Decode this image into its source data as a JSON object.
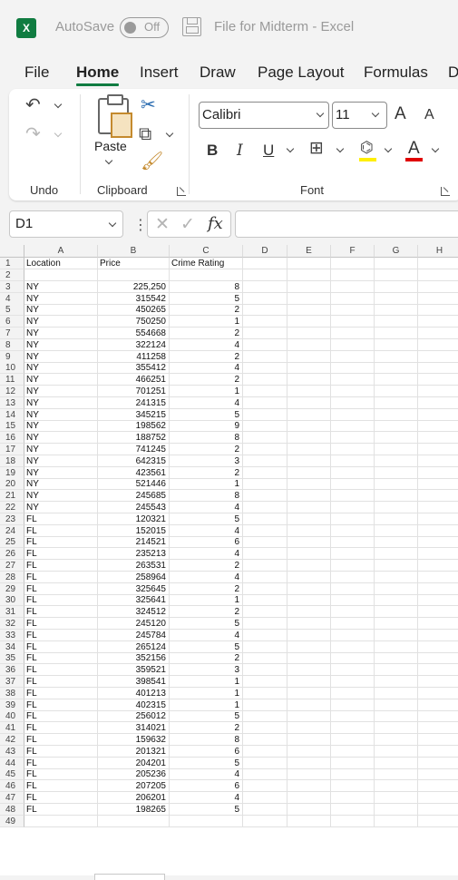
{
  "titlebar": {
    "app_logo": "X",
    "autosave_label": "AutoSave",
    "autosave_state": "Off",
    "document_title": "File for Midterm  -  Excel"
  },
  "tabs": [
    "File",
    "Home",
    "Insert",
    "Draw",
    "Page Layout",
    "Formulas",
    "D"
  ],
  "active_tab": "Home",
  "ribbon": {
    "groups": {
      "undo": "Undo",
      "clipboard": "Clipboard",
      "font": "Font"
    },
    "paste_label": "Paste",
    "font_name": "Calibri",
    "font_size": "11",
    "bold": "B",
    "italic": "I",
    "underline": "U",
    "grow_font": "A",
    "shrink_font": "A",
    "font_color_glyph": "A",
    "highlight_color": "#ffef00",
    "font_color": "#e00000"
  },
  "formula_bar": {
    "name_box": "D1",
    "fx": "fx",
    "value": ""
  },
  "accent_color": "#107c41",
  "columns": [
    "A",
    "B",
    "C",
    "D",
    "E",
    "F",
    "G",
    "H"
  ],
  "header_row": {
    "row": "1",
    "a": "Location",
    "b": "Price",
    "c": "Crime Rating"
  },
  "rows": [
    {
      "row": "2",
      "a": "",
      "b": "",
      "c": ""
    },
    {
      "row": "3",
      "a": "NY",
      "b": "225,250",
      "c": "8"
    },
    {
      "row": "4",
      "a": "NY",
      "b": "315542",
      "c": "5"
    },
    {
      "row": "5",
      "a": "NY",
      "b": "450265",
      "c": "2"
    },
    {
      "row": "6",
      "a": "NY",
      "b": "750250",
      "c": "1"
    },
    {
      "row": "7",
      "a": "NY",
      "b": "554668",
      "c": "2"
    },
    {
      "row": "8",
      "a": "NY",
      "b": "322124",
      "c": "4"
    },
    {
      "row": "9",
      "a": "NY",
      "b": "411258",
      "c": "2"
    },
    {
      "row": "10",
      "a": "NY",
      "b": "355412",
      "c": "4"
    },
    {
      "row": "11",
      "a": "NY",
      "b": "466251",
      "c": "2"
    },
    {
      "row": "12",
      "a": "NY",
      "b": "701251",
      "c": "1"
    },
    {
      "row": "13",
      "a": "NY",
      "b": "241315",
      "c": "4"
    },
    {
      "row": "14",
      "a": "NY",
      "b": "345215",
      "c": "5"
    },
    {
      "row": "15",
      "a": "NY",
      "b": "198562",
      "c": "9"
    },
    {
      "row": "16",
      "a": "NY",
      "b": "188752",
      "c": "8"
    },
    {
      "row": "17",
      "a": "NY",
      "b": "741245",
      "c": "2"
    },
    {
      "row": "18",
      "a": "NY",
      "b": "642315",
      "c": "3"
    },
    {
      "row": "19",
      "a": "NY",
      "b": "423561",
      "c": "2"
    },
    {
      "row": "20",
      "a": "NY",
      "b": "521446",
      "c": "1"
    },
    {
      "row": "21",
      "a": "NY",
      "b": "245685",
      "c": "8"
    },
    {
      "row": "22",
      "a": "NY",
      "b": "245543",
      "c": "4"
    },
    {
      "row": "23",
      "a": "FL",
      "b": "120321",
      "c": "5"
    },
    {
      "row": "24",
      "a": "FL",
      "b": "152015",
      "c": "4"
    },
    {
      "row": "25",
      "a": "FL",
      "b": "214521",
      "c": "6"
    },
    {
      "row": "26",
      "a": "FL",
      "b": "235213",
      "c": "4"
    },
    {
      "row": "27",
      "a": "FL",
      "b": "263531",
      "c": "2"
    },
    {
      "row": "28",
      "a": "FL",
      "b": "258964",
      "c": "4"
    },
    {
      "row": "29",
      "a": "FL",
      "b": "325645",
      "c": "2"
    },
    {
      "row": "30",
      "a": "FL",
      "b": "325641",
      "c": "1"
    },
    {
      "row": "31",
      "a": "FL",
      "b": "324512",
      "c": "2"
    },
    {
      "row": "32",
      "a": "FL",
      "b": "245120",
      "c": "5"
    },
    {
      "row": "33",
      "a": "FL",
      "b": "245784",
      "c": "4"
    },
    {
      "row": "34",
      "a": "FL",
      "b": "265124",
      "c": "5"
    },
    {
      "row": "35",
      "a": "FL",
      "b": "352156",
      "c": "2"
    },
    {
      "row": "36",
      "a": "FL",
      "b": "359521",
      "c": "3"
    },
    {
      "row": "37",
      "a": "FL",
      "b": "398541",
      "c": "1"
    },
    {
      "row": "38",
      "a": "FL",
      "b": "401213",
      "c": "1"
    },
    {
      "row": "39",
      "a": "FL",
      "b": "402315",
      "c": "1"
    },
    {
      "row": "40",
      "a": "FL",
      "b": "256012",
      "c": "5"
    },
    {
      "row": "41",
      "a": "FL",
      "b": "314021",
      "c": "2"
    },
    {
      "row": "42",
      "a": "FL",
      "b": "159632",
      "c": "8"
    },
    {
      "row": "43",
      "a": "FL",
      "b": "201321",
      "c": "6"
    },
    {
      "row": "44",
      "a": "FL",
      "b": "204201",
      "c": "5"
    },
    {
      "row": "45",
      "a": "FL",
      "b": "205236",
      "c": "4"
    },
    {
      "row": "46",
      "a": "FL",
      "b": "207205",
      "c": "6"
    },
    {
      "row": "47",
      "a": "FL",
      "b": "206201",
      "c": "4"
    },
    {
      "row": "48",
      "a": "FL",
      "b": "198265",
      "c": "5"
    },
    {
      "row": "49",
      "a": "",
      "b": "",
      "c": ""
    }
  ]
}
